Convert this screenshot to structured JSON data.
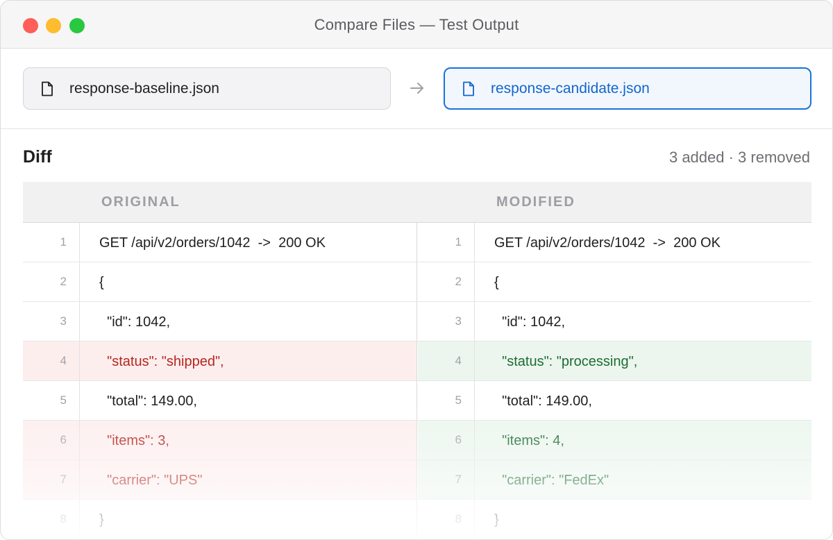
{
  "window": {
    "title": "Compare Files — Test Output"
  },
  "files": {
    "baseline": {
      "name": "response-baseline.json",
      "icon": "document-icon"
    },
    "candidate": {
      "name": "response-candidate.json",
      "icon": "document-icon"
    },
    "separator_icon": "arrow-right-icon"
  },
  "diff": {
    "title": "Diff",
    "summary": "3 added · 3 removed",
    "headers": {
      "original": "ORIGINAL",
      "modified": "MODIFIED"
    },
    "rows": [
      {
        "line": "1",
        "original": "GET /api/v2/orders/1042  ->  200 OK",
        "modified": "GET /api/v2/orders/1042  ->  200 OK",
        "change": "none"
      },
      {
        "line": "2",
        "original": "{",
        "modified": "{",
        "change": "none"
      },
      {
        "line": "3",
        "original": "  \"id\": 1042,",
        "modified": "  \"id\": 1042,",
        "change": "none"
      },
      {
        "line": "4",
        "original": "  \"status\": \"shipped\",",
        "modified": "  \"status\": \"processing\",",
        "change": "changed"
      },
      {
        "line": "5",
        "original": "  \"total\": 149.00,",
        "modified": "  \"total\": 149.00,",
        "change": "none"
      },
      {
        "line": "6",
        "original": "  \"items\": 3,",
        "modified": "  \"items\": 4,",
        "change": "changed"
      },
      {
        "line": "7",
        "original": "  \"carrier\": \"UPS\"",
        "modified": "  \"carrier\": \"FedEx\"",
        "change": "changed"
      },
      {
        "line": "8",
        "original": "}",
        "modified": "}",
        "change": "none"
      }
    ]
  },
  "colors": {
    "accent": "#1a73d9",
    "removed_bg": "#fdeeee",
    "removed_text": "#b3261e",
    "added_bg": "#ecf6ee",
    "added_text": "#1d6b33"
  }
}
